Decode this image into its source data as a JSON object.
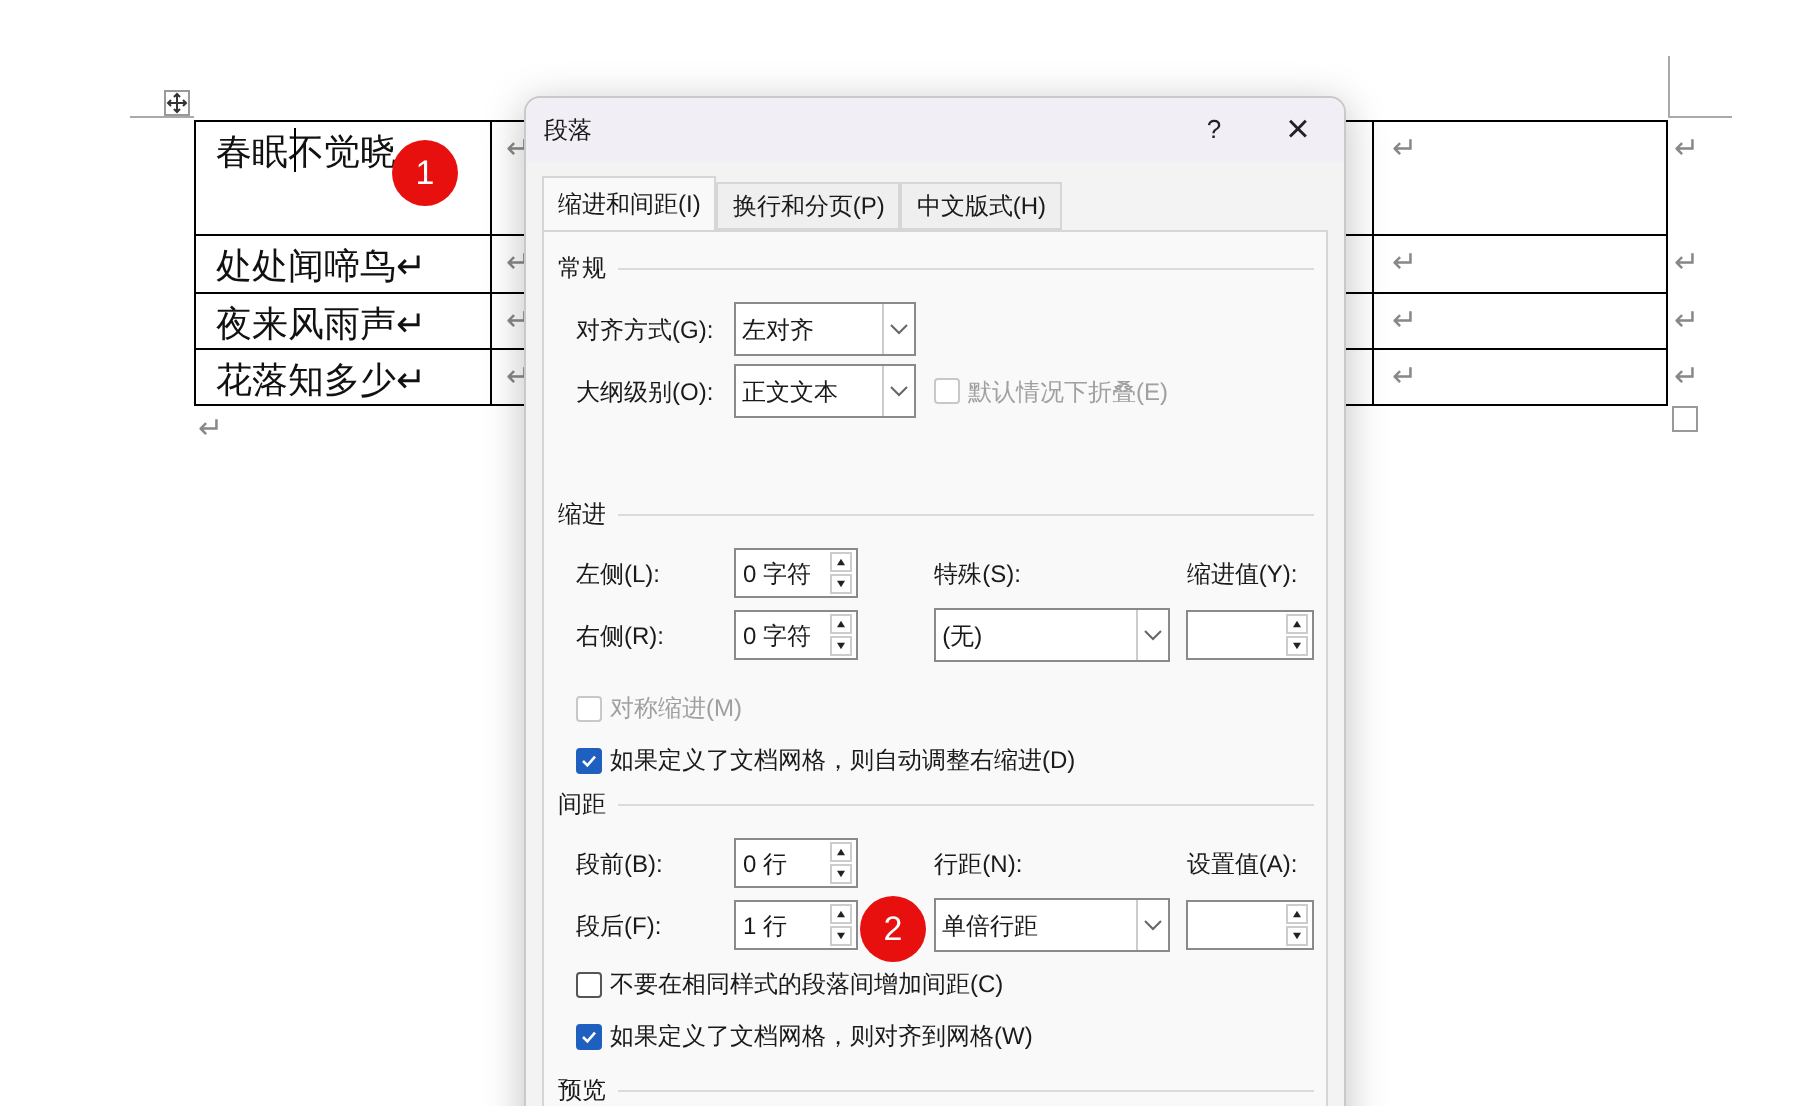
{
  "document": {
    "rows": [
      {
        "cells": [
          "春眠不觉晓",
          "↵",
          "↵"
        ],
        "row_end": "↵"
      },
      {
        "cells": [
          "处处闻啼鸟↵",
          "↵",
          "↵"
        ],
        "row_end": "↵"
      },
      {
        "cells": [
          "夜来风雨声↵",
          "↵",
          "↵"
        ],
        "row_end": "↵"
      },
      {
        "cells": [
          "花落知多少↵",
          "↵",
          "↵"
        ],
        "row_end": "↵"
      }
    ],
    "paragraph_mark": "↵"
  },
  "callouts": [
    {
      "label": "1"
    },
    {
      "label": "2"
    }
  ],
  "dialog": {
    "title": "段落",
    "help": "?",
    "close": "×",
    "tabs": [
      {
        "label": "缩进和间距(I)",
        "selected": true
      },
      {
        "label": "换行和分页(P)",
        "selected": false
      },
      {
        "label": "中文版式(H)",
        "selected": false
      }
    ],
    "general": {
      "heading": "常规",
      "alignment": {
        "label": "对齐方式(G):",
        "value": "左对齐"
      },
      "outline": {
        "label": "大纲级别(O):",
        "value": "正文文本"
      },
      "collapse": {
        "label": "默认情况下折叠(E)",
        "checked": false,
        "disabled": true
      }
    },
    "indent": {
      "heading": "缩进",
      "left": {
        "label": "左侧(L):",
        "value": "0 字符"
      },
      "right": {
        "label": "右侧(R):",
        "value": "0 字符"
      },
      "special": {
        "label": "特殊(S):",
        "value": "(无)"
      },
      "by": {
        "label": "缩进值(Y):"
      },
      "mirror": {
        "label": "对称缩进(M)",
        "checked": false,
        "disabled": true
      },
      "auto_adjust": {
        "label": "如果定义了文档网格，则自动调整右缩进(D)",
        "checked": true,
        "disabled": false
      }
    },
    "spacing": {
      "heading": "间距",
      "before": {
        "label": "段前(B):",
        "value": "0 行"
      },
      "after": {
        "label": "段后(F):",
        "value": "1 行"
      },
      "line_spacing": {
        "label": "行距(N):",
        "value": "单倍行距"
      },
      "at": {
        "label": "设置值(A):"
      },
      "no_space": {
        "label": "不要在相同样式的段落间增加间距(C)",
        "checked": false,
        "disabled": false
      },
      "snap": {
        "label": "如果定义了文档网格，则对齐到网格(W)",
        "checked": true,
        "disabled": false
      }
    },
    "preview": {
      "heading": "预览"
    }
  }
}
